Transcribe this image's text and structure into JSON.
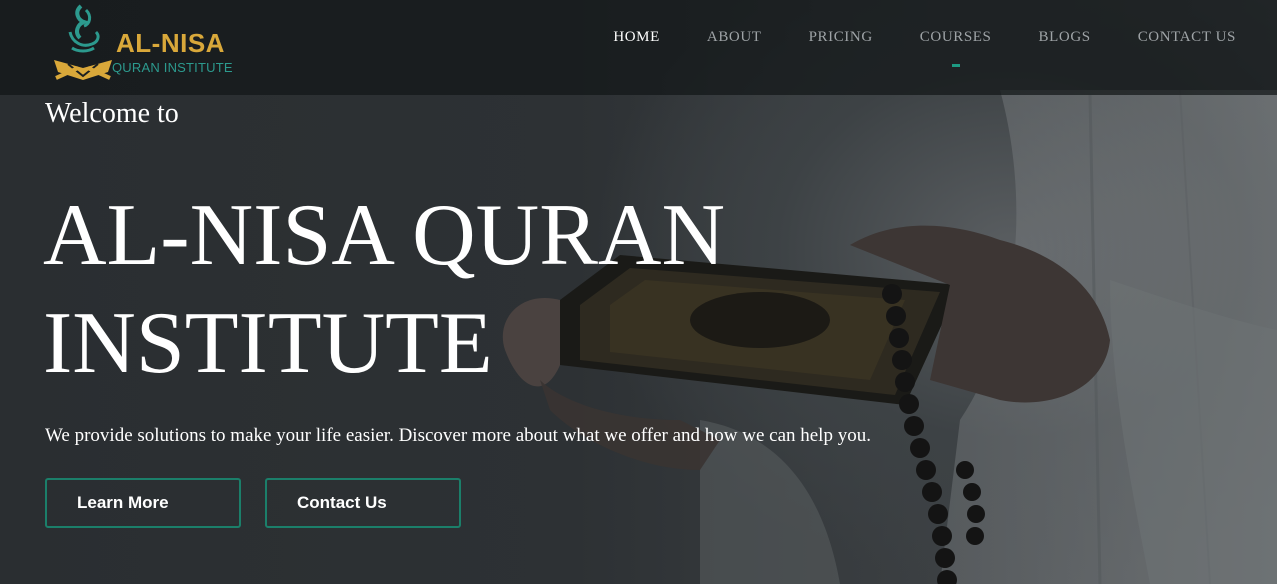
{
  "brand": {
    "name": "AL-NISA",
    "subtitle": "QURAN INSTITUTE",
    "gold": "#d9a83a",
    "teal": "#2c9a8e"
  },
  "nav": {
    "items": [
      {
        "label": "HOME",
        "active": true
      },
      {
        "label": "ABOUT",
        "active": false
      },
      {
        "label": "PRICING",
        "active": false
      },
      {
        "label": "COURSES",
        "active": false,
        "indicator": true
      },
      {
        "label": "BLOGS",
        "active": false
      },
      {
        "label": "CONTACT US",
        "active": false
      }
    ]
  },
  "hero": {
    "welcome": "Welcome to",
    "title_line1": "AL-NISA QURAN",
    "title_line2": "INSTITUTE",
    "tagline": "We provide solutions to make your life easier. Discover more about what we offer and how we can help you.",
    "buttons": {
      "learn_more": "Learn More",
      "contact_us": "Contact Us"
    },
    "accent": "#1b7f6a"
  },
  "icons": {
    "logo": "quran-on-stand-calligraphy-logo",
    "background": "hands-holding-quran-with-prayer-beads"
  }
}
